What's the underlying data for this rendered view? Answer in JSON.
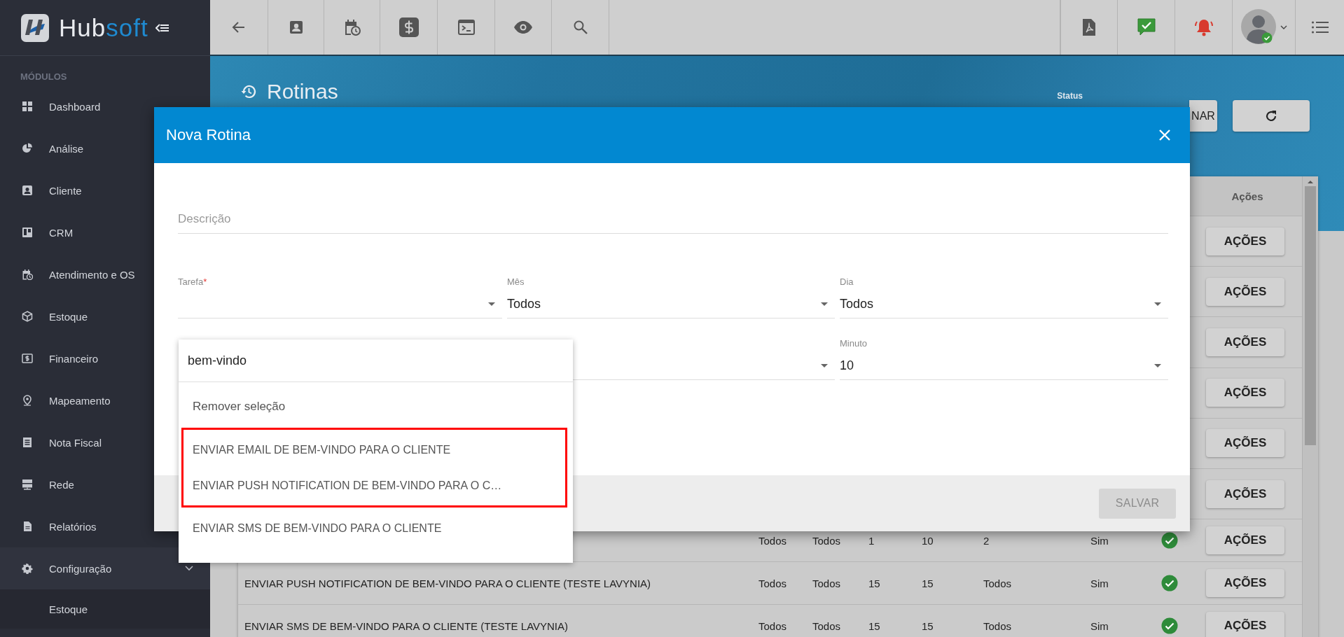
{
  "brand": {
    "text": "Hub",
    "accent": "soft"
  },
  "sidebar": {
    "heading": "MÓDULOS",
    "items": [
      {
        "label": "Dashboard",
        "kind": "link"
      },
      {
        "label": "Análise",
        "kind": "link"
      },
      {
        "label": "Cliente",
        "kind": "link"
      },
      {
        "label": "CRM",
        "kind": "link"
      },
      {
        "label": "Atendimento e OS",
        "kind": "link"
      },
      {
        "label": "Estoque",
        "kind": "link"
      },
      {
        "label": "Financeiro",
        "kind": "link"
      },
      {
        "label": "Mapeamento",
        "kind": "link"
      },
      {
        "label": "Nota Fiscal",
        "kind": "link"
      },
      {
        "label": "Rede",
        "kind": "link"
      },
      {
        "label": "Relatórios",
        "kind": "link"
      },
      {
        "label": "Configuração",
        "kind": "group",
        "expanded": true,
        "children": [
          {
            "label": "Estoque",
            "kind": "link"
          }
        ]
      }
    ]
  },
  "page": {
    "title": "Rotinas",
    "status_label": "Status",
    "buttons": [
      {
        "kind": "text",
        "label": "NAR"
      },
      {
        "kind": "refresh"
      }
    ]
  },
  "table": {
    "columns": [
      {
        "label": "Ações"
      }
    ],
    "rows": [
      {
        "action": "AÇÕES"
      },
      {
        "action": "AÇÕES"
      },
      {
        "action": "AÇÕES"
      },
      {
        "action": "AÇÕES"
      },
      {
        "action": "AÇÕES"
      },
      {
        "action": "AÇÕES"
      },
      {
        "cells": [
          "Todos",
          "Todos",
          "1",
          "10",
          "2",
          "Sim"
        ],
        "active": true,
        "action": "AÇÕES"
      },
      {
        "name": "ENVIAR PUSH NOTIFICATION DE BEM-VINDO PARA O CLIENTE (TESTE LAVYNIA)",
        "cells": [
          "Todos",
          "Todos",
          "15",
          "15",
          "Todos",
          "Sim"
        ],
        "active": true,
        "action": "AÇÕES"
      },
      {
        "name": "ENVIAR SMS DE BEM-VINDO PARA O CLIENTE (TESTE LAVYNIA)",
        "cells": [
          "Todos",
          "Todos",
          "15",
          "15",
          "Todos",
          "Sim"
        ],
        "active": true,
        "action": "AÇÕES"
      }
    ]
  },
  "dialog": {
    "title": "Nova Rotina",
    "fields": [
      {
        "kind": "text",
        "placeholder": "Descrição"
      },
      {
        "kind": "select",
        "label": "Tarefa",
        "required_mark": "*"
      },
      {
        "kind": "select",
        "label": "Mês",
        "value": "Todos"
      },
      {
        "kind": "select",
        "label": "Dia",
        "value": "Todos"
      },
      {
        "kind": "select"
      },
      {
        "kind": "select",
        "label": "Minuto",
        "value": "10"
      }
    ],
    "save_button": {
      "label": "SALVAR",
      "disabled": true
    },
    "dropdown": {
      "search_value": "bem-vindo",
      "options": [
        {
          "label": "Remover seleção",
          "kind": "clear",
          "marked": false
        },
        {
          "label": "ENVIAR EMAIL DE BEM-VINDO PARA O CLIENTE",
          "kind": "option",
          "marked": true
        },
        {
          "label": "ENVIAR PUSH NOTIFICATION DE BEM-VINDO PARA O C…",
          "kind": "option",
          "marked": true
        },
        {
          "label": "ENVIAR SMS DE BEM-VINDO PARA O CLIENTE",
          "kind": "option",
          "marked": false
        }
      ]
    }
  }
}
